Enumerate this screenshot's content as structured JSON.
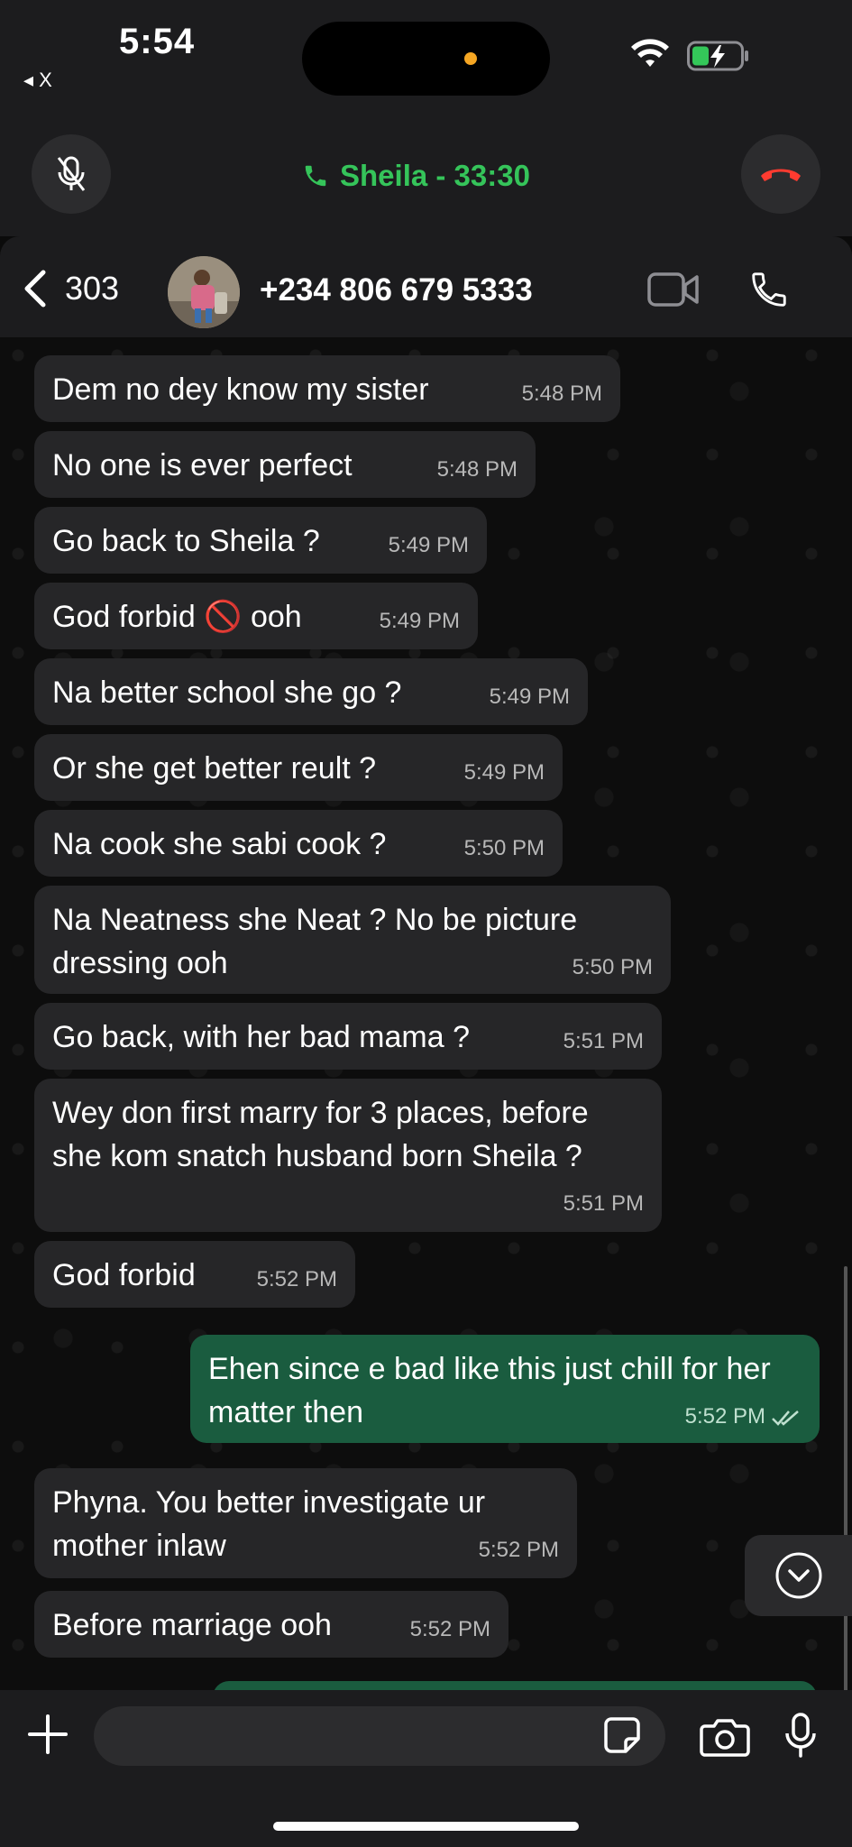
{
  "status_bar": {
    "time": "5:54",
    "back_app_label": "◂ X"
  },
  "call": {
    "title": "Sheila - 33:30"
  },
  "chat_header": {
    "back_count": "303",
    "contact": "+234 806 679 5333"
  },
  "messages": [
    {
      "dir": "in",
      "text": "Dem no dey know my sister",
      "time": "5:48 PM"
    },
    {
      "dir": "in",
      "text": "No one is ever perfect",
      "time": "5:48 PM"
    },
    {
      "dir": "in",
      "text": "Go back to Sheila ?",
      "time": "5:49 PM"
    },
    {
      "dir": "in",
      "text": "God forbid 🚫 ooh",
      "time": "5:49 PM"
    },
    {
      "dir": "in",
      "text": "Na better school she go ?",
      "time": "5:49 PM"
    },
    {
      "dir": "in",
      "text": "Or she get better reult ?",
      "time": "5:49 PM"
    },
    {
      "dir": "in",
      "text": "Na cook she sabi cook ?",
      "time": "5:50 PM"
    },
    {
      "dir": "in",
      "text": "Na Neatness she Neat ? No be picture dressing ooh",
      "time": "5:50 PM"
    },
    {
      "dir": "in",
      "text": "Go back, with her bad mama ?",
      "time": "5:51 PM"
    },
    {
      "dir": "in",
      "text": "Wey don first marry for 3 places, before she kom snatch husband born Sheila ?",
      "time": "5:51 PM"
    },
    {
      "dir": "in",
      "text": "God forbid",
      "time": "5:52 PM"
    },
    {
      "dir": "out",
      "text": "Ehen since e bad like this just chill for her matter then",
      "time": "5:52 PM"
    },
    {
      "dir": "in",
      "text": "Phyna. You better investigate ur mother inlaw",
      "time": "5:52 PM"
    },
    {
      "dir": "in",
      "text": "Before marriage ooh",
      "time": "5:52 PM"
    }
  ],
  "input": {
    "placeholder": ""
  },
  "icons": {
    "mute": "mic-off-icon",
    "end_call": "end-call-icon",
    "back": "chevron-left-icon",
    "video": "video-icon",
    "phone": "phone-icon",
    "plus": "plus-icon",
    "sticker": "sticker-icon",
    "camera": "camera-icon",
    "mic": "mic-icon",
    "scroll_down": "chevron-down-circle-icon"
  },
  "colors": {
    "call_green": "#35c45a",
    "end_call_red": "#ff3b30",
    "outgoing_bubble": "#1a5c3f",
    "incoming_bubble": "#262628",
    "battery_charge": "#34c759",
    "island_indicator": "#f5a623"
  }
}
